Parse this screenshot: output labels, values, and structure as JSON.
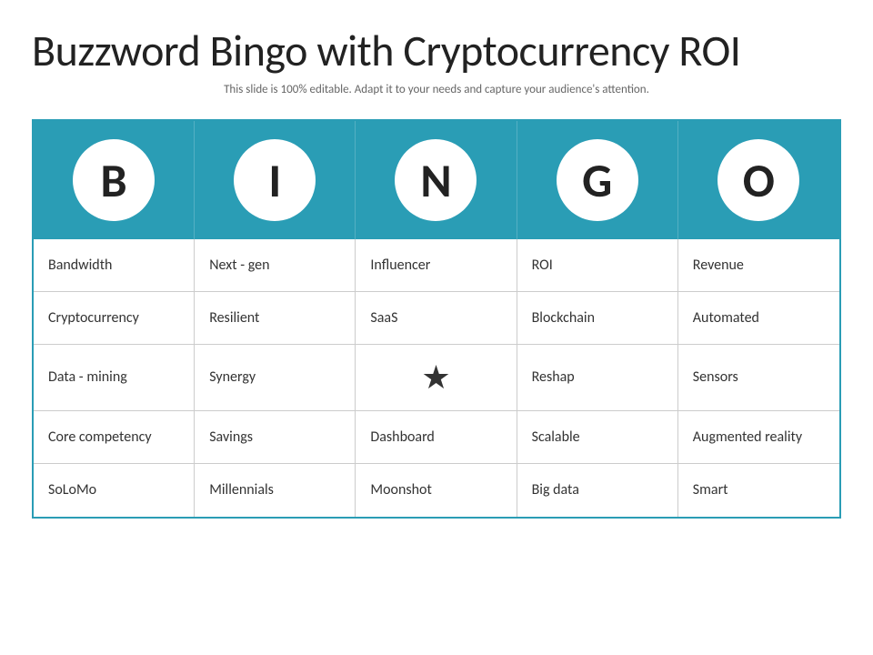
{
  "title": "Buzzword Bingo with Cryptocurrency ROI",
  "subtitle": "This slide is 100% editable. Adapt it to your needs and capture your audience's attention.",
  "bingo_letters": [
    "B",
    "I",
    "N",
    "G",
    "O"
  ],
  "accent_color": "#2a9db5",
  "rows": [
    [
      "Bandwidth",
      "Next - gen",
      "Influencer",
      "ROI",
      "Revenue"
    ],
    [
      "Cryptocurrency",
      "Resilient",
      "SaaS",
      "Blockchain",
      "Automated"
    ],
    [
      "Data - mining",
      "Synergy",
      "★",
      "Reshap",
      "Sensors"
    ],
    [
      "Core competency",
      "Savings",
      "Dashboard",
      "Scalable",
      "Augmented reality"
    ],
    [
      "SoLoMo",
      "Millennials",
      "Moonshot",
      "Big data",
      "Smart"
    ]
  ]
}
